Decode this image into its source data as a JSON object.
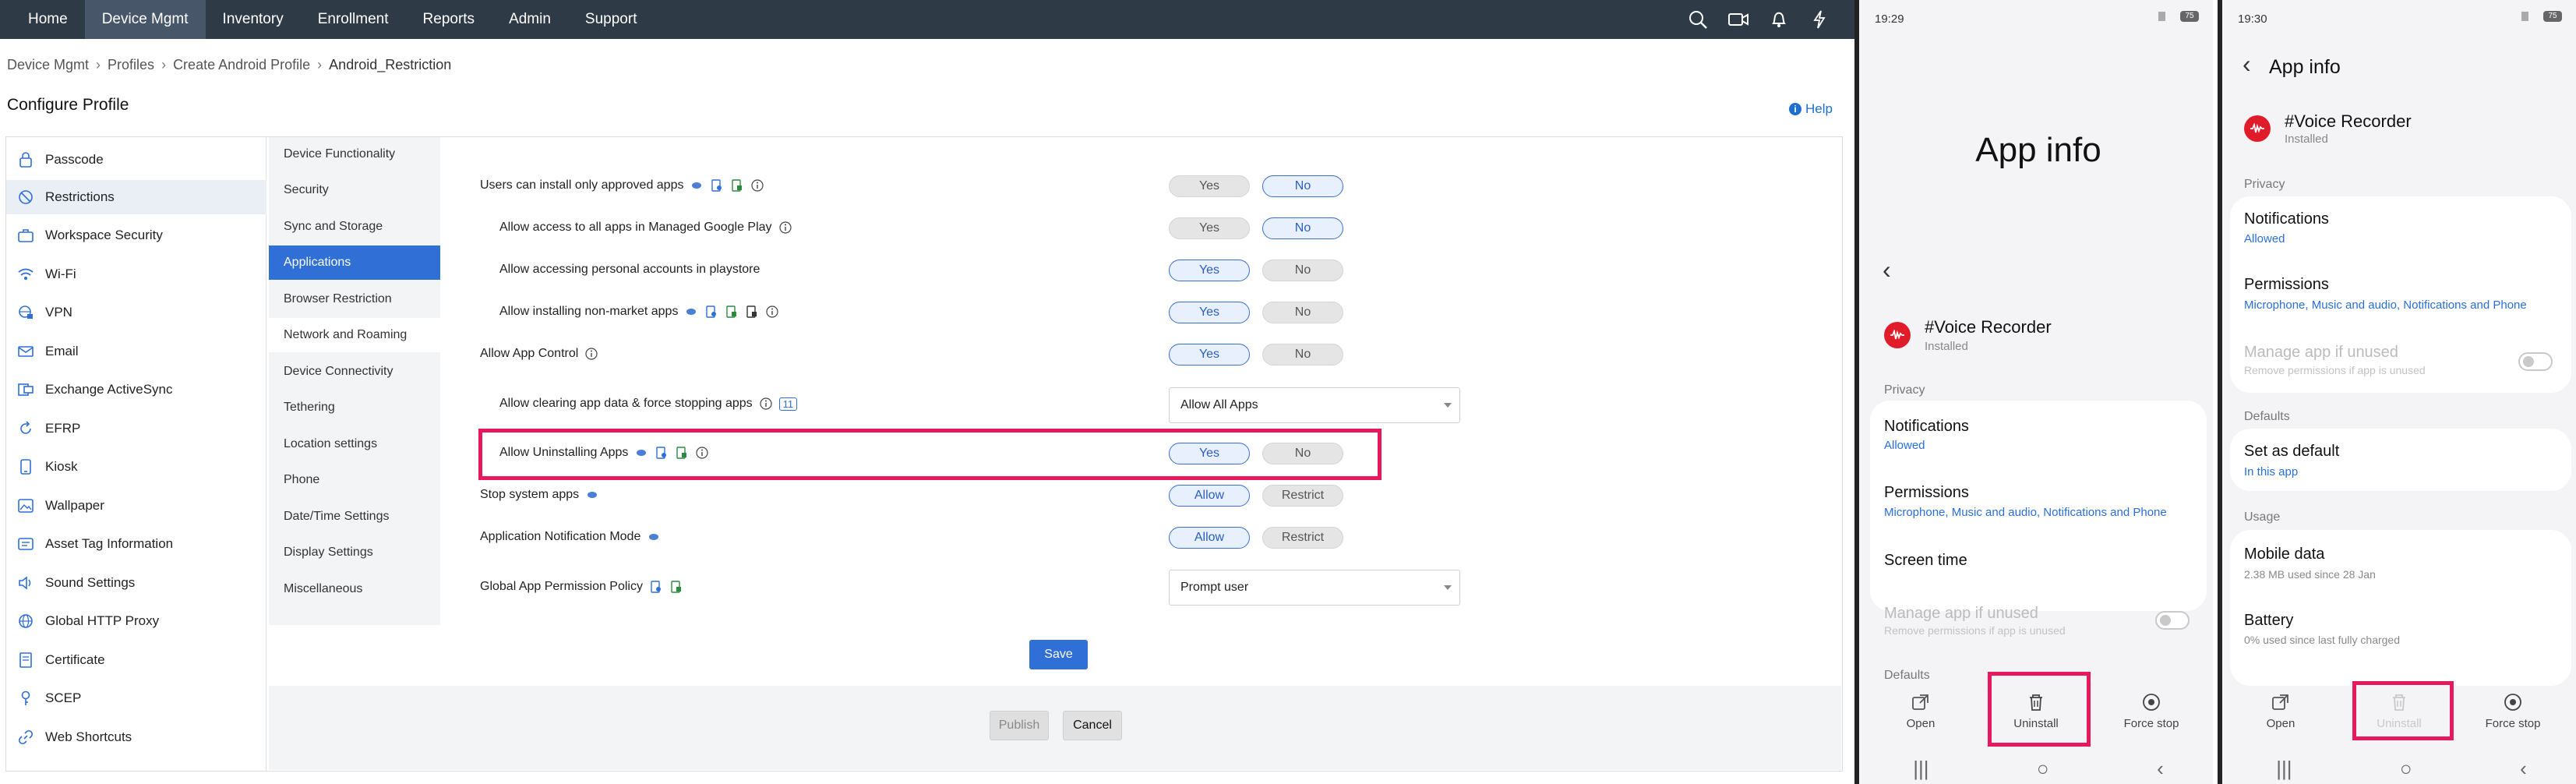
{
  "nav": {
    "items": [
      "Home",
      "Device Mgmt",
      "Inventory",
      "Enrollment",
      "Reports",
      "Admin",
      "Support"
    ],
    "active": "Device Mgmt"
  },
  "breadcrumb": [
    "Device Mgmt",
    "Profiles",
    "Create Android Profile",
    "Android_Restriction"
  ],
  "page_title": "Configure Profile",
  "help_label": "Help",
  "sidebar": {
    "items": [
      "Passcode",
      "Restrictions",
      "Workspace Security",
      "Wi-Fi",
      "VPN",
      "Email",
      "Exchange ActiveSync",
      "EFRP",
      "Kiosk",
      "Wallpaper",
      "Asset Tag Information",
      "Sound Settings",
      "Global HTTP Proxy",
      "Certificate",
      "SCEP",
      "Web Shortcuts"
    ],
    "active": "Restrictions"
  },
  "subnav": {
    "items": [
      "Device Functionality",
      "Security",
      "Sync and Storage",
      "Applications",
      "Browser Restriction",
      "Network and Roaming",
      "Device Connectivity",
      "Tethering",
      "Location settings",
      "Phone",
      "Date/Time Settings",
      "Display Settings",
      "Miscellaneous"
    ],
    "active": "Applications"
  },
  "settings": [
    {
      "label": "Users can install only approved apps",
      "yes": "Yes",
      "no": "No",
      "selected": "no"
    },
    {
      "label": "Allow access to all apps in Managed Google Play",
      "yes": "Yes",
      "no": "No",
      "selected": "no",
      "badge": ""
    },
    {
      "label": "Allow accessing personal accounts in playstore",
      "yes": "Yes",
      "no": "No",
      "selected": "yes"
    },
    {
      "label": "Allow installing non-market apps",
      "yes": "Yes",
      "no": "No",
      "selected": "yes"
    },
    {
      "label": "Allow App Control",
      "yes": "Yes",
      "no": "No",
      "selected": "yes"
    },
    {
      "label": "Allow clearing app data & force stopping apps",
      "badge": "11",
      "value": "Allow All Apps"
    },
    {
      "label": "Allow Uninstalling Apps",
      "yes": "Yes",
      "no": "No",
      "selected": "yes"
    },
    {
      "label": "Stop system apps",
      "yes": "Allow",
      "no": "Restrict",
      "selected": "yes"
    },
    {
      "label": "Application Notification Mode",
      "yes": "Allow",
      "no": "Restrict",
      "selected": "yes"
    },
    {
      "label": "Global App Permission Policy",
      "value": "Prompt user"
    }
  ],
  "buttons": {
    "save": "Save",
    "publish": "Publish",
    "cancel": "Cancel"
  },
  "phone_a": {
    "time": "19:29",
    "battery": "75",
    "title": "App info",
    "app_name": "#Voice Recorder",
    "app_status": "Installed",
    "privacy": "Privacy",
    "notifications": "Notifications",
    "notifications_sub": "Allowed",
    "permissions": "Permissions",
    "permissions_sub": "Microphone, Music and audio, Notifications and Phone",
    "screen_time": "Screen time",
    "manage": "Manage app if unused",
    "manage_sub": "Remove permissions if app is unused",
    "defaults": "Defaults",
    "actions": [
      "Open",
      "Uninstall",
      "Force stop"
    ]
  },
  "phone_b": {
    "time": "19:30",
    "battery": "75",
    "title": "App info",
    "app_name": "#Voice Recorder",
    "app_status": "Installed",
    "privacy": "Privacy",
    "notifications": "Notifications",
    "notifications_sub": "Allowed",
    "permissions": "Permissions",
    "permissions_sub": "Microphone, Music and audio, Notifications and Phone",
    "manage": "Manage app if unused",
    "manage_sub": "Remove permissions if app is unused",
    "defaults": "Defaults",
    "set_default": "Set as default",
    "set_default_sub": "In this app",
    "usage": "Usage",
    "mobile_data": "Mobile data",
    "mobile_data_sub": "2.38 MB used since 28 Jan",
    "battery_item": "Battery",
    "battery_sub": "0% used since last fully charged",
    "actions": [
      "Open",
      "Uninstall",
      "Force stop"
    ]
  },
  "colors": {
    "nav_bg": "#2f3a47",
    "accent": "#2f6fd6",
    "highlight": "#e8185c"
  }
}
